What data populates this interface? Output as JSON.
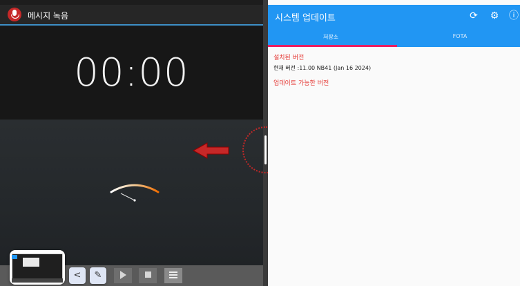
{
  "recorder": {
    "app_title": "메시지 녹음",
    "timer": "00:00",
    "icon": "microphone-icon"
  },
  "recorder_toolbar": {
    "play_icon": "play-icon",
    "stop_icon": "stop-icon",
    "list_icon": "list-icon"
  },
  "overlay": {
    "share_glyph": "<",
    "edit_glyph": "✎"
  },
  "system_update": {
    "title": "시스템 업데이트",
    "tabs": [
      {
        "label": "저장소",
        "active": true
      },
      {
        "label": "FOTA",
        "active": false
      }
    ],
    "installed_heading": "설치된 버전",
    "current_version": "현재 버전 :11.00 NB41 (Jan 16 2024)",
    "available_heading": "업데이트 가능한 버전",
    "toolbar_icons": [
      "refresh-icon",
      "gear-icon",
      "info-icon"
    ]
  },
  "colors": {
    "accent_blue": "#2196f3",
    "tab_indicator": "#e91e63",
    "heading_red": "#e53935",
    "arrow_red": "#c62828"
  }
}
